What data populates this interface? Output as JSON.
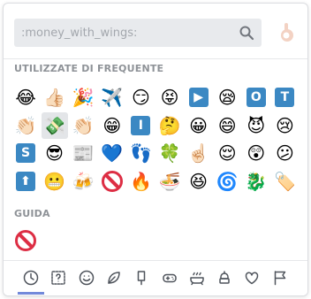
{
  "search": {
    "placeholder": ":money_with_wings:",
    "value": ""
  },
  "skin_tone_icon": "skin-tone-hand-icon",
  "sections": {
    "frequent": {
      "title": "UTILIZZATE DI FREQUENTE"
    },
    "guide": {
      "title": "GUIDA"
    }
  },
  "frequent_emojis": [
    {
      "name": "joy",
      "glyph": "😂"
    },
    {
      "name": "thumbs-up",
      "glyph": "👍🏻"
    },
    {
      "name": "party-popper",
      "glyph": "🎉"
    },
    {
      "name": "airplane",
      "glyph": "✈️"
    },
    {
      "name": "smirk",
      "glyph": "😏"
    },
    {
      "name": "stuck-out-tongue-closed-eyes",
      "glyph": "😝"
    },
    {
      "name": "arrow-forward",
      "square": "▶",
      "color": "#3b88c3"
    },
    {
      "name": "sleepy",
      "glyph": "😪"
    },
    {
      "name": "o-button",
      "square": "O",
      "color": "#3b88c3"
    },
    {
      "name": "t-letter",
      "square": "T",
      "color": "#3b88c3"
    },
    {
      "name": "clap",
      "glyph": "👏🏻"
    },
    {
      "name": "money-with-wings",
      "glyph": "💸",
      "selected": true
    },
    {
      "name": "clap-alt",
      "glyph": "👏🏻"
    },
    {
      "name": "grin",
      "glyph": "😁"
    },
    {
      "name": "i-letter",
      "square": "I",
      "color": "#3b88c3"
    },
    {
      "name": "thinking",
      "glyph": "🤔"
    },
    {
      "name": "grinning",
      "glyph": "😀"
    },
    {
      "name": "smile",
      "glyph": "😄"
    },
    {
      "name": "smiling-imp",
      "glyph": "😈"
    },
    {
      "name": "cry",
      "glyph": "😢"
    },
    {
      "name": "s-letter",
      "square": "S",
      "color": "#3b88c3"
    },
    {
      "name": "sunglasses",
      "glyph": "😎"
    },
    {
      "name": "newspaper",
      "glyph": "📰"
    },
    {
      "name": "blue-heart",
      "glyph": "💙"
    },
    {
      "name": "feet",
      "glyph": "👣"
    },
    {
      "name": "four-leaf-clover",
      "glyph": "🍀"
    },
    {
      "name": "point-up",
      "glyph": "☝🏻"
    },
    {
      "name": "relieved",
      "glyph": "😌"
    },
    {
      "name": "hushed",
      "glyph": "😲"
    },
    {
      "name": "confused",
      "glyph": "😕"
    },
    {
      "name": "arrow-up",
      "square": "⬆",
      "color": "#3b88c3"
    },
    {
      "name": "grimacing",
      "glyph": "😬"
    },
    {
      "name": "beers",
      "glyph": "🍻"
    },
    {
      "name": "no-entry-sign",
      "nosign": true
    },
    {
      "name": "fire",
      "glyph": "🔥"
    },
    {
      "name": "ramen",
      "glyph": "🍜"
    },
    {
      "name": "laughing",
      "glyph": "😆"
    },
    {
      "name": "eye-swirl",
      "glyph": "🌀"
    },
    {
      "name": "dragon",
      "glyph": "🐉"
    },
    {
      "name": "custom-banner",
      "glyph": "🏷️"
    }
  ],
  "guide_emojis": [
    {
      "name": "no-entry-sign",
      "nosign": true
    }
  ],
  "tabs": [
    {
      "name": "recent",
      "icon": "clock-icon",
      "active": true
    },
    {
      "name": "custom",
      "icon": "question-box-icon"
    },
    {
      "name": "people",
      "icon": "face-icon"
    },
    {
      "name": "nature",
      "icon": "leaf-icon"
    },
    {
      "name": "food",
      "icon": "popsicle-icon"
    },
    {
      "name": "activity",
      "icon": "gamepad-icon"
    },
    {
      "name": "travel",
      "icon": "bath-icon"
    },
    {
      "name": "objects",
      "icon": "lamp-icon"
    },
    {
      "name": "symbols",
      "icon": "heart-icon"
    },
    {
      "name": "flags",
      "icon": "flag-icon"
    }
  ],
  "colors": {
    "accent": "#7289da",
    "tile_blue": "#3b88c3",
    "no_entry_red": "#dd2e44"
  }
}
